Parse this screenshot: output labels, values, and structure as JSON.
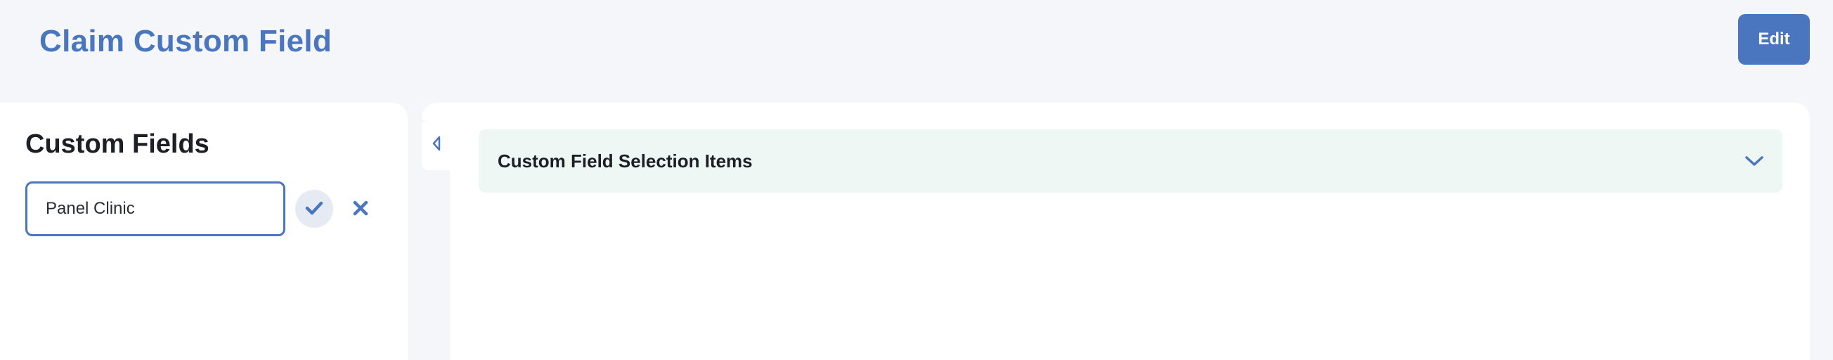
{
  "header": {
    "title": "Claim Custom Field",
    "edit_label": "Edit"
  },
  "left_panel": {
    "heading": "Custom Fields",
    "name_input": {
      "value": "Panel Clinic",
      "placeholder": ""
    },
    "confirm_icon": "check-icon",
    "cancel_icon": "close-icon"
  },
  "right_panel": {
    "collapse_icon": "caret-left-icon",
    "accordion": {
      "title": "Custom Field Selection Items",
      "icon": "chevron-down-icon",
      "expanded": false
    }
  },
  "colors": {
    "accent": "#4a76c0",
    "background": "#f5f6fa",
    "panel": "#ffffff",
    "accordion_bg": "#eef7f4",
    "confirm_bg": "#e6eaf3"
  }
}
